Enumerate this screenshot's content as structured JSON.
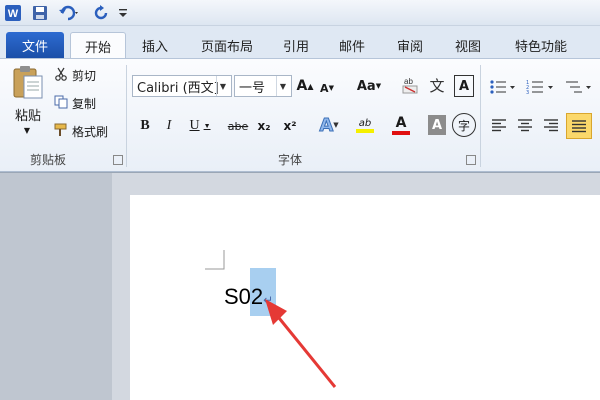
{
  "app": {
    "name": "Word"
  },
  "quick_access": {
    "save": "save-icon",
    "undo": "undo-icon",
    "redo": "redo-icon"
  },
  "tabs": [
    "文件",
    "开始",
    "插入",
    "页面布局",
    "引用",
    "邮件",
    "审阅",
    "视图",
    "特色功能"
  ],
  "clipboard": {
    "paste_label": "粘贴",
    "cut_label": "剪切",
    "copy_label": "复制",
    "format_painter_label": "格式刷",
    "group_label": "剪贴板"
  },
  "font": {
    "name": "Calibri (西文]",
    "size": "一号",
    "group_label": "字体",
    "bold": "B",
    "italic": "I",
    "underline": "U",
    "strike": "abe",
    "subscript": "x₂",
    "superscript": "x²",
    "grow": "A",
    "shrink": "A",
    "change_case": "Aa",
    "clear": "A",
    "phonetic": "文",
    "border": "A",
    "text_effect": "A",
    "highlight": "ab",
    "font_color": "A",
    "shading": "A",
    "enclose": "字"
  },
  "document": {
    "text": "S02",
    "para_mark": "↵"
  },
  "colors": {
    "accent": "#2d6bd1",
    "arrow": "#e53935",
    "highlight": "#a8cff0"
  }
}
